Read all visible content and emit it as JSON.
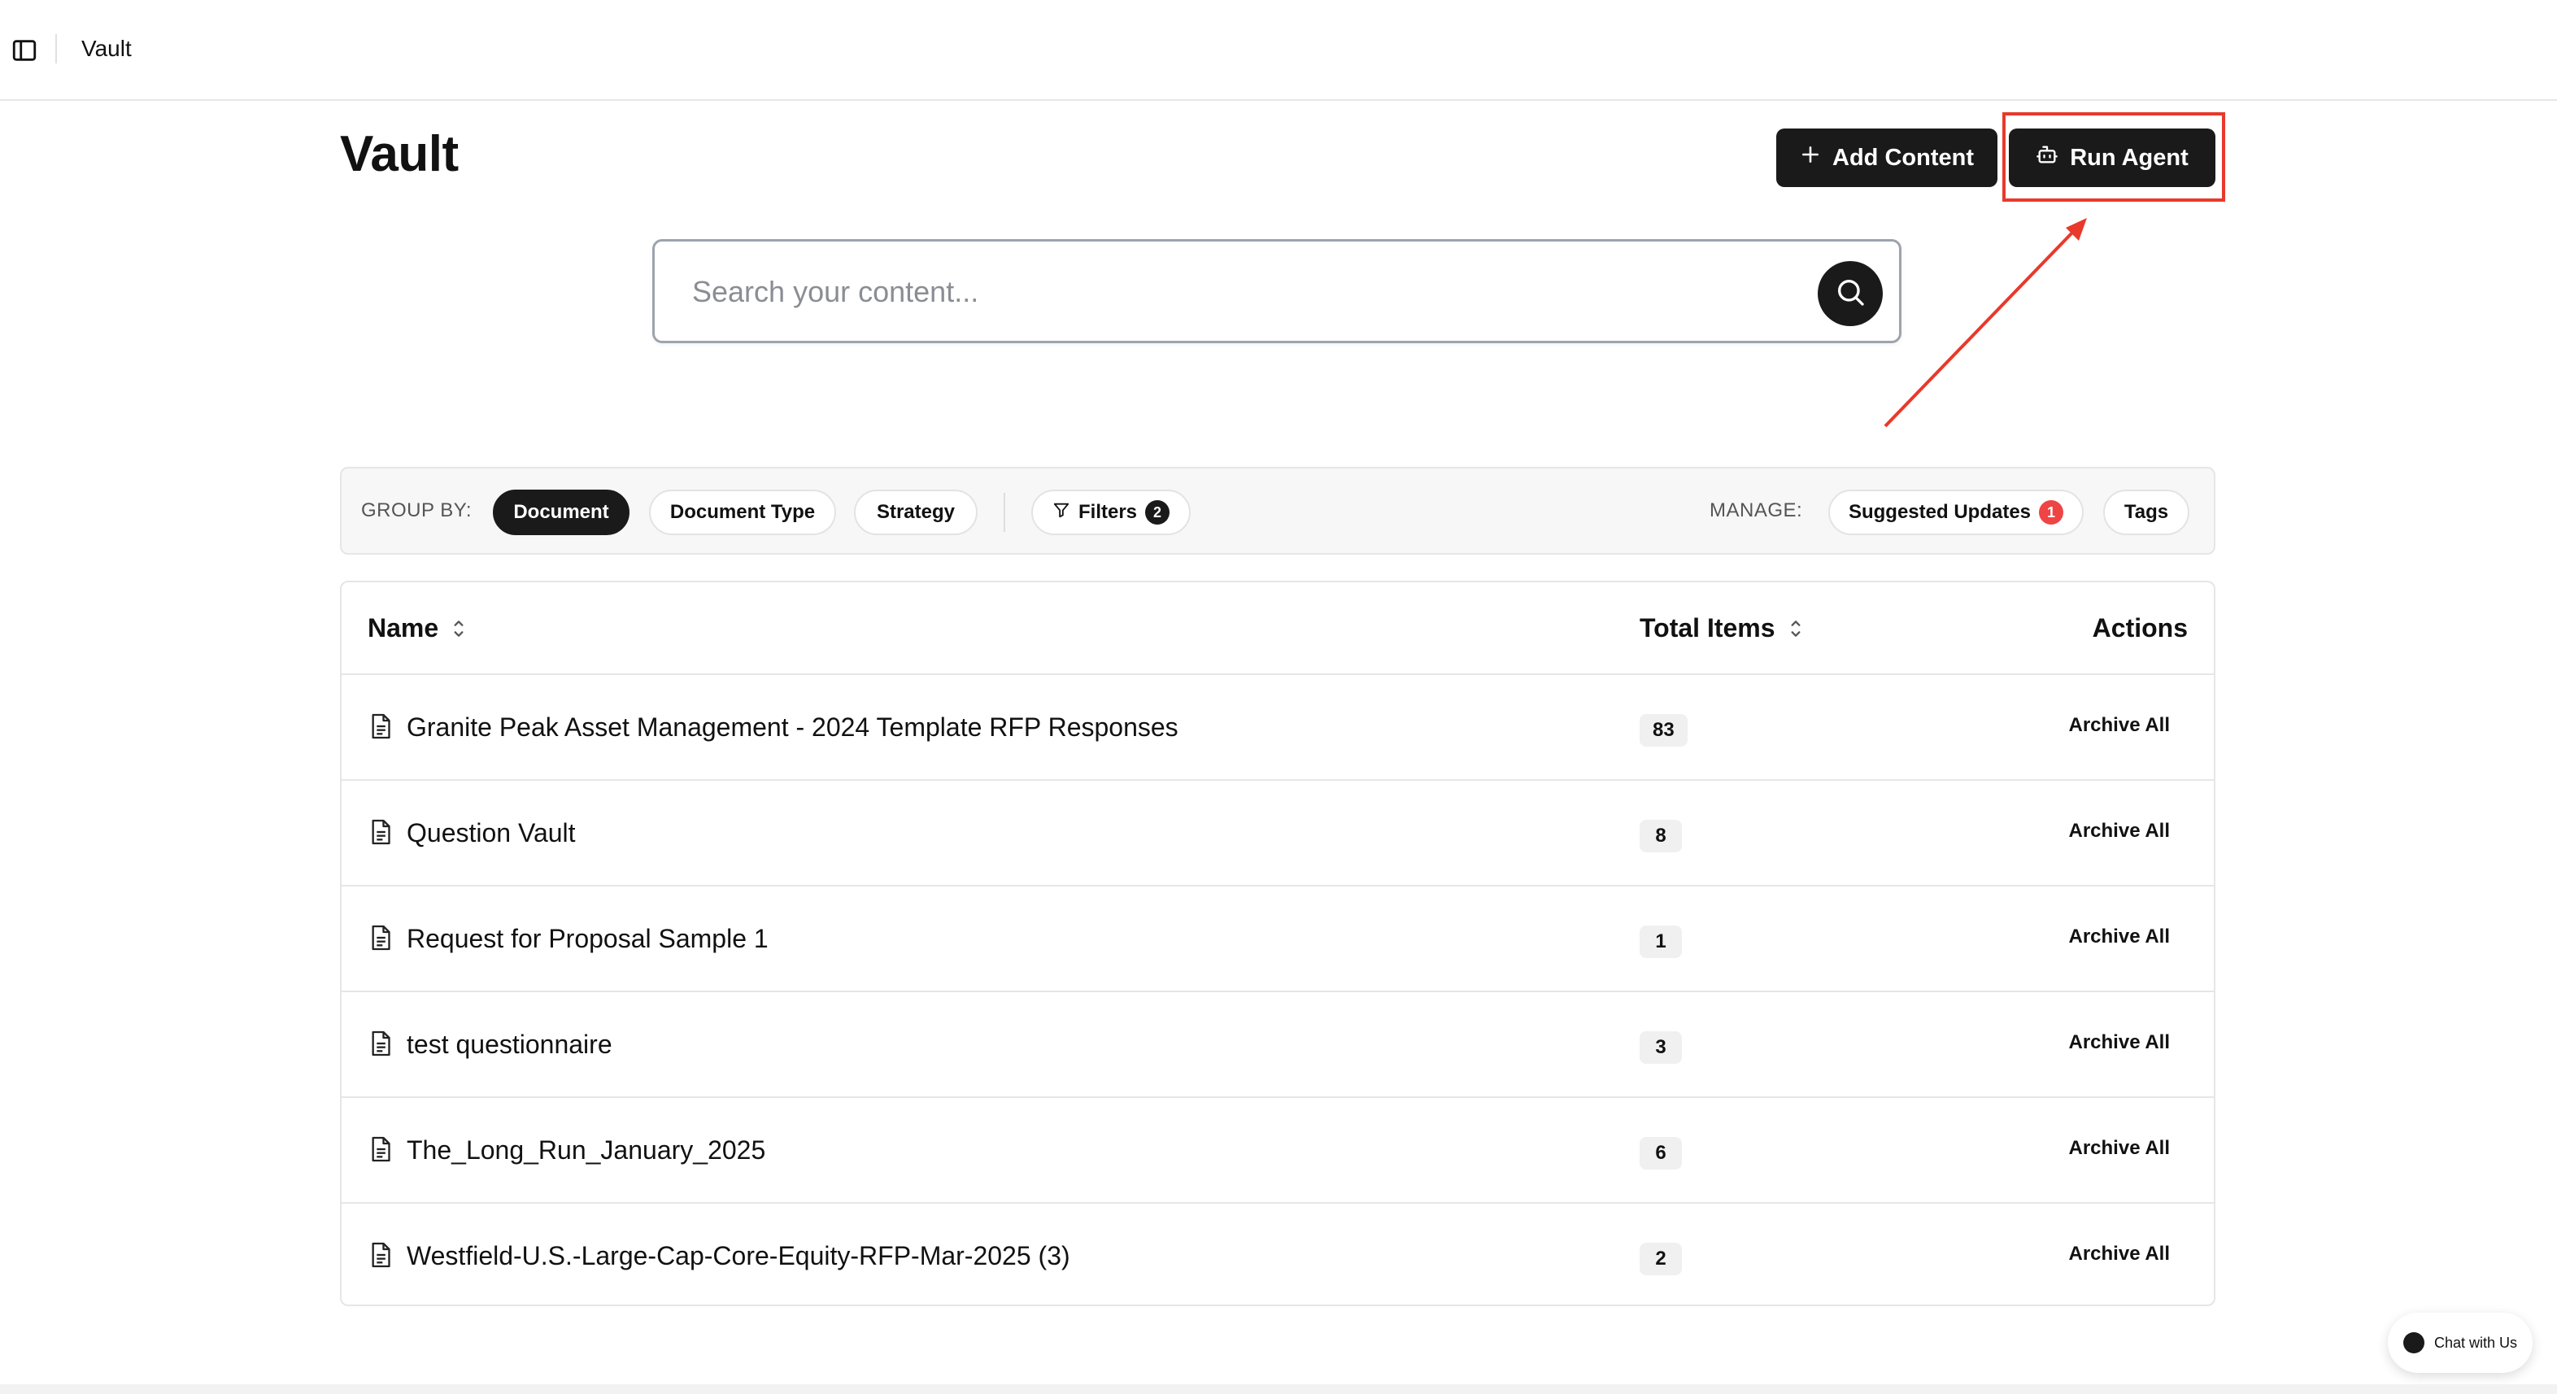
{
  "topbar": {
    "breadcrumb": "Vault",
    "sidebar_toggle_icon": "sidebar-panel-icon"
  },
  "header": {
    "title": "Vault",
    "add_content_label": "Add Content",
    "add_content_icon": "plus-icon",
    "run_agent_label": "Run Agent",
    "run_agent_icon": "bot-icon",
    "highlight_color": "#e8392b"
  },
  "search": {
    "placeholder": "Search your content...",
    "value": "",
    "icon": "search-icon"
  },
  "toolbar": {
    "group_by_label": "GROUP BY:",
    "group_options": [
      {
        "label": "Document",
        "active": true
      },
      {
        "label": "Document Type",
        "active": false
      },
      {
        "label": "Strategy",
        "active": false
      }
    ],
    "filters_label": "Filters",
    "filters_count": "2",
    "manage_label": "MANAGE:",
    "suggested_updates_label": "Suggested Updates",
    "suggested_updates_count": "1",
    "tags_label": "Tags"
  },
  "table": {
    "columns": {
      "name": "Name",
      "total_items": "Total Items",
      "actions": "Actions"
    },
    "rows": [
      {
        "name": "Granite Peak Asset Management - 2024 Template RFP Responses",
        "total": "83",
        "action": "Archive All"
      },
      {
        "name": "Question Vault",
        "total": "8",
        "action": "Archive All"
      },
      {
        "name": "Request for Proposal Sample 1",
        "total": "1",
        "action": "Archive All"
      },
      {
        "name": "test questionnaire",
        "total": "3",
        "action": "Archive All"
      },
      {
        "name": "The_Long_Run_January_2025",
        "total": "6",
        "action": "Archive All"
      },
      {
        "name": "Westfield-U.S.-Large-Cap-Core-Equity-RFP-Mar-2025 (3)",
        "total": "2",
        "action": "Archive All"
      }
    ]
  },
  "chat_widget": {
    "label": "Chat with Us"
  },
  "colors": {
    "primary_dark": "#1a1a1a",
    "badge_red": "#ef4444",
    "annotation_red": "#e8392b"
  }
}
